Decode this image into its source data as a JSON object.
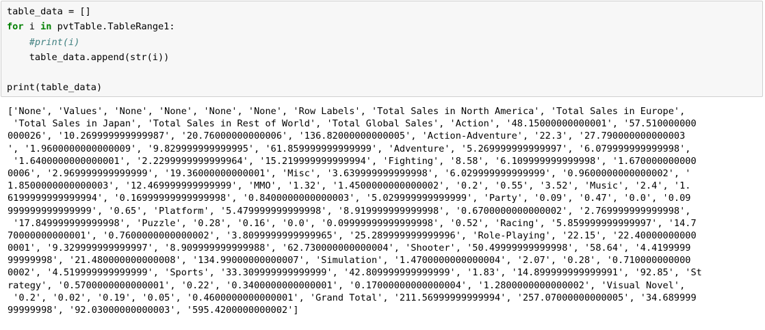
{
  "input_cell": {
    "line1": "table_data = []",
    "line2": {
      "kw_for": "for",
      "var_i": " i ",
      "kw_in": "in",
      "rest": " pvtTable.TableRange1:"
    },
    "line3": {
      "indent": "    ",
      "comment": "#print(i)"
    },
    "line4": "    table_data.append(str(i))",
    "line5": "",
    "line6": "print(table_data)"
  },
  "output_cell": {
    "lines": [
      "['None', 'Values', 'None', 'None', 'None', 'None', 'Row Labels', 'Total Sales in North America', 'Total Sales in Europe',",
      " 'Total Sales in Japan', 'Total Sales in Rest of World', 'Total Global Sales', 'Action', '48.15000000000001', '57.510000000",
      "000026', '10.269999999999987', '20.76000000000006', '136.82000000000005', 'Action-Adventure', '22.3', '27.790000000000003",
      "', '1.9600000000000009', '9.829999999999995', '61.859999999999999', 'Adventure', '5.269999999999997', '6.079999999999998',",
      " '1.6400000000000001', '2.2299999999999964', '15.219999999999994', 'Fighting', '8.58', '6.109999999999998', '1.670000000000",
      "0006', '2.969999999999999', '19.36000000000001', 'Misc', '3.639999999999998', '6.029999999999999', '0.9600000000000002', '",
      "1.8500000000000003', '12.469999999999999', 'MMO', '1.32', '1.4500000000000002', '0.2', '0.55', '3.52', 'Music', '2.4', '1.",
      "6199999999999994', '0.16999999999999998', '0.8400000000000003', '5.029999999999999', 'Party', '0.09', '0.47', '0.0', '0.09",
      "999999999999999', '0.65', 'Platform', '5.479999999999998', '8.919999999999998', '0.6700000000000002', '2.769999999999998',",
      " '17.849999999999998', 'Puzzle', '0.28', '0.16', '0.0', '0.09999999999999998', '0.52', 'Racing', '5.859999999999997', '14.7",
      "70000000000001', '0.7600000000000002', '3.8099999999999965', '25.289999999999996', 'Role-Playing', '22.15', '22.40000000000",
      "0001', '9.329999999999997', '8.909999999999988', '62.730000000000004', 'Shooter', '50.49999999999998', '58.64', '4.4199999",
      "99999998', '21.480000000000008', '134.99000000000007', 'Simulation', '1.4700000000000004', '2.07', '0.28', '0.710000000000",
      "0002', '4.519999999999999', 'Sports', '33.309999999999999', '42.809999999999999', '1.83', '14.899999999999991', '92.85', 'St",
      "rategy', '0.5700000000000001', '0.22', '0.3400000000000001', '0.17000000000000004', '1.2800000000000002', 'Visual Novel',",
      " '0.2', '0.02', '0.19', '0.05', '0.4600000000000001', 'Grand Total', '211.56999999999994', '257.07000000000005', '34.689999",
      "99999998', '92.03000000000003', '595.4200000000002']"
    ]
  }
}
